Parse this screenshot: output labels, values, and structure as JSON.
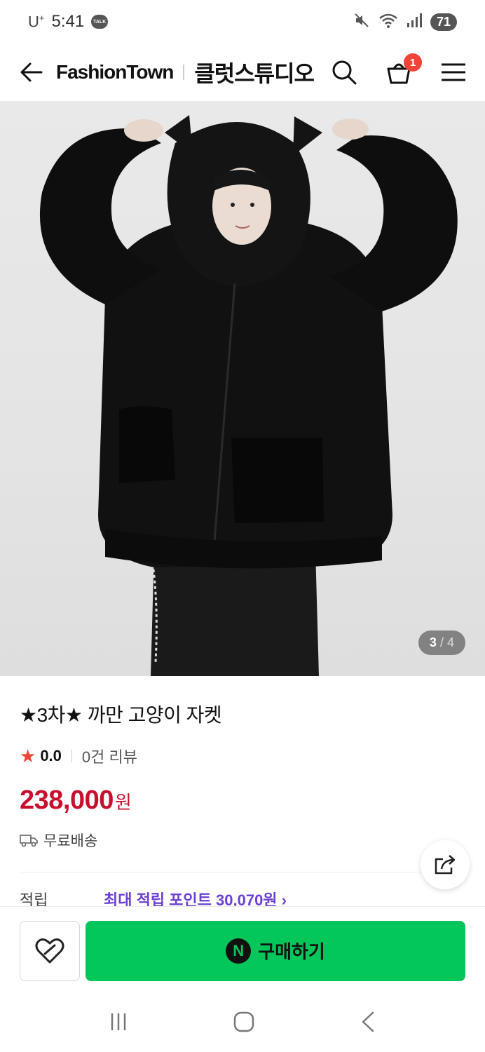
{
  "status_bar": {
    "carrier": "U",
    "carrier_sup": "+",
    "time": "5:41",
    "talk_badge": "TALK",
    "battery": "71"
  },
  "header": {
    "brand": "FashionTown",
    "store_name": "클럿스튜디오",
    "cart_count": "1"
  },
  "product": {
    "image_counter_current": "3",
    "image_counter_sep": "/",
    "image_counter_total": "4",
    "title": "★3차★ 까만 고양이 자켓",
    "rating": "0.0",
    "review_count": "0건 리뷰",
    "price": "238,000",
    "price_unit": "원",
    "delivery": "무료배송",
    "points_label": "적립",
    "points_value": "최대 적립 포인트 30,070원 ›"
  },
  "actions": {
    "npay_mark": "N",
    "buy_label": "구매하기"
  },
  "colors": {
    "price_red": "#c8102e",
    "buy_green": "#03c75a",
    "points_purple": "#6b3fd4",
    "badge_red": "#f04438"
  },
  "icons": [
    "back-arrow-icon",
    "search-icon",
    "shopping-bag-icon",
    "menu-icon",
    "star-icon",
    "truck-icon",
    "share-icon",
    "wishlist-heart-icon",
    "recent-apps-icon",
    "home-icon",
    "back-nav-icon",
    "mute-icon",
    "wifi-icon",
    "signal-icon"
  ]
}
